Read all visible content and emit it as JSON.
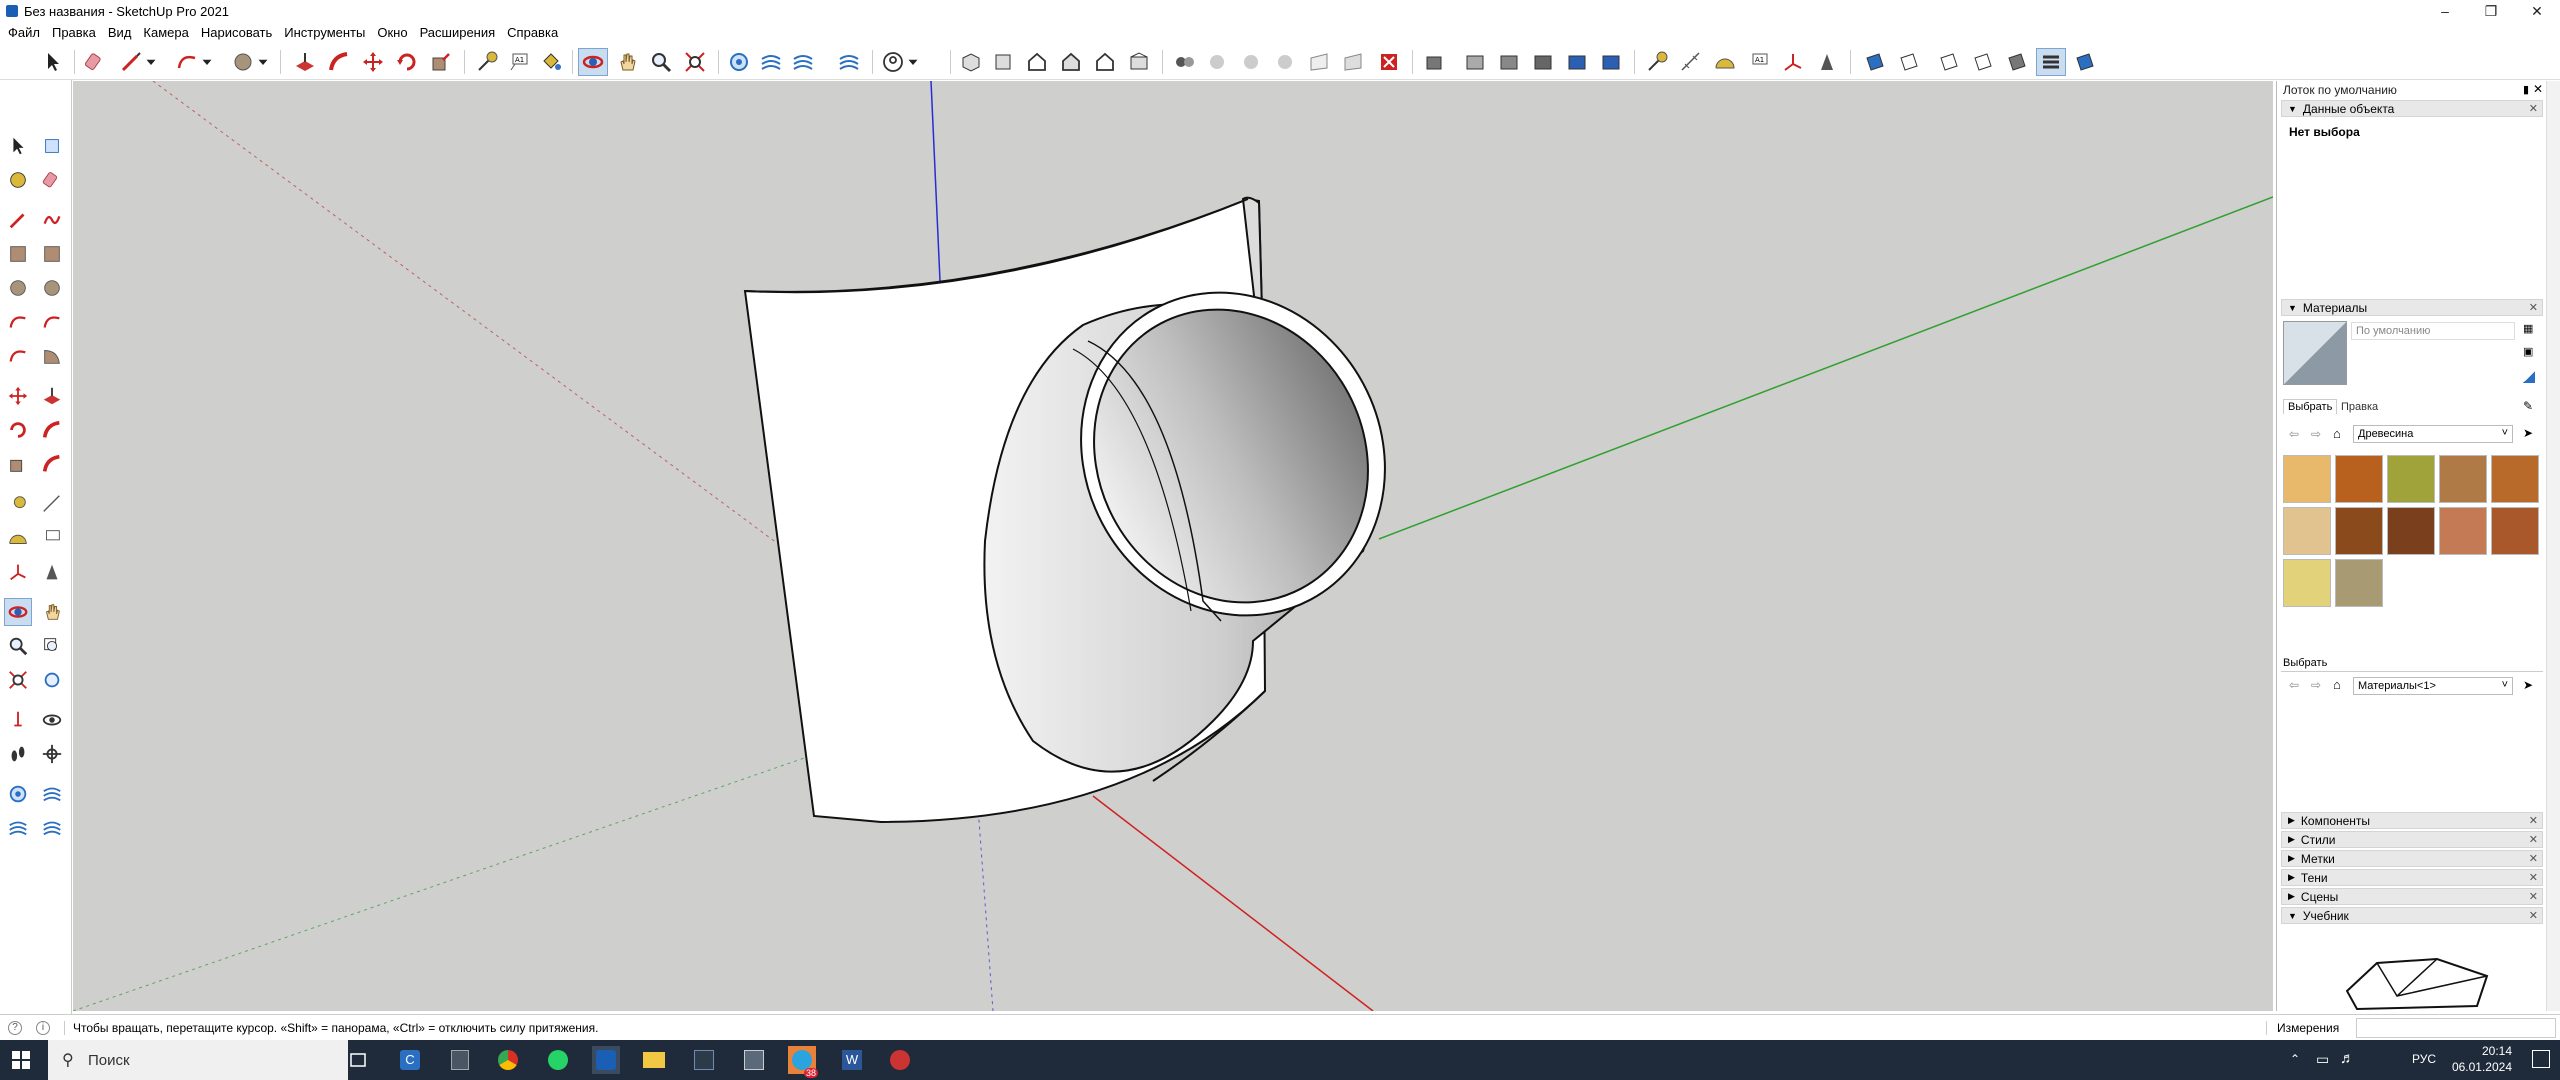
{
  "window": {
    "title": "Без названия - SketchUp Pro 2021"
  },
  "menu": [
    "Файл",
    "Правка",
    "Вид",
    "Камера",
    "Нарисовать",
    "Инструменты",
    "Окно",
    "Расширения",
    "Справка"
  ],
  "status": {
    "hint": "Чтобы вращать, перетащите курсор. «Shift» = панорама, «Ctrl» = отключить силу притяжения.",
    "measurements_label": "Измерения"
  },
  "tray": {
    "title": "Лоток по умолчанию",
    "entity_info": {
      "header": "Данные объекта",
      "selection": "Нет выбора"
    },
    "materials": {
      "header": "Материалы",
      "current_name": "По умолчанию",
      "tab_select": "Выбрать",
      "tab_edit": "Правка",
      "library": "Древесина",
      "swatch_colors": [
        "#e8b86b",
        "#b8611f",
        "#a0a23a",
        "#b07a46",
        "#b86a2a",
        "#e0c38e",
        "#8a4a1c",
        "#7a3f1c",
        "#c47a55",
        "#a8582a",
        "#e2d27a",
        "#a89a72"
      ],
      "second_select_label": "Выбрать",
      "second_library": "Материалы<1>"
    },
    "collapsed_panels": [
      "Компоненты",
      "Стили",
      "Метки",
      "Тени",
      "Сцены"
    ],
    "instructor": "Учебник"
  },
  "taskbar": {
    "search_placeholder": "Поиск",
    "language": "РУС",
    "time": "20:14",
    "date": "06.01.2024",
    "telegram_badge": "38"
  }
}
